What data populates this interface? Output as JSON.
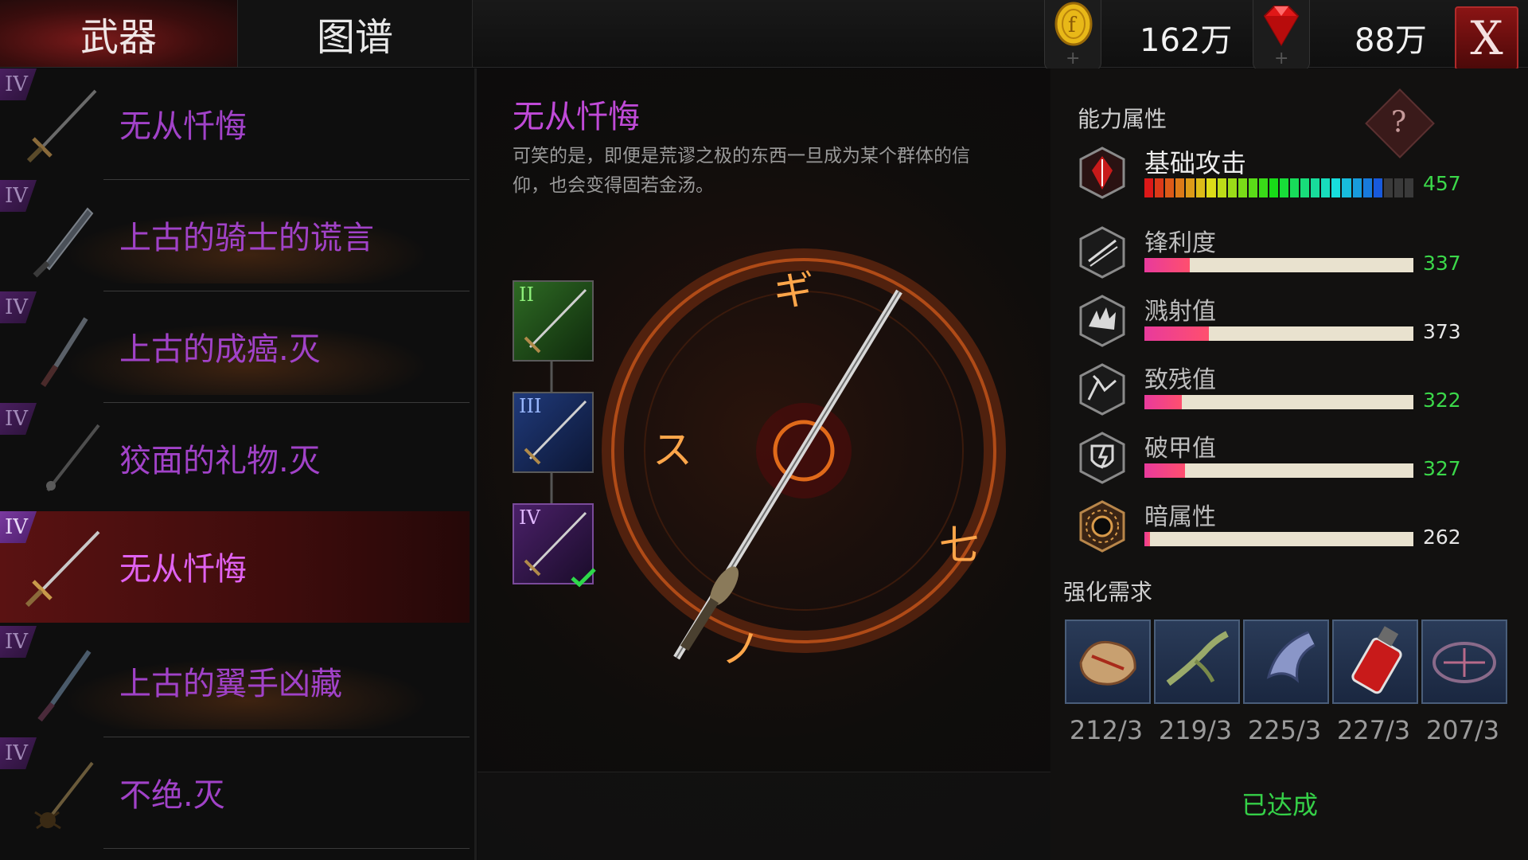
{
  "tabs": {
    "weapons": "武器",
    "codex": "图谱"
  },
  "currency": {
    "gold": {
      "icon": "gold-coin-icon",
      "value": "162万"
    },
    "gem": {
      "icon": "red-gem-icon",
      "value": "88万"
    },
    "plus": "+"
  },
  "close_label": "X",
  "weapon_list": [
    {
      "rank": "IV",
      "name": "无从忏悔",
      "icon": "sword-icon"
    },
    {
      "rank": "IV",
      "name": "上古的骑士的谎言",
      "icon": "greatsword-icon"
    },
    {
      "rank": "IV",
      "name": "上古的成癌.灭",
      "icon": "dagger-icon"
    },
    {
      "rank": "IV",
      "name": "狡面的礼物.灭",
      "icon": "spear-icon"
    },
    {
      "rank": "IV",
      "name": "无从忏悔",
      "icon": "sword-icon"
    },
    {
      "rank": "IV",
      "name": "上古的翼手凶藏",
      "icon": "blade-icon"
    },
    {
      "rank": "IV",
      "name": "不绝.灭",
      "icon": "spider-blade-icon"
    }
  ],
  "selected_weapon": {
    "name": "无从忏悔",
    "description": "可笑的是，即便是荒谬之极的东西一旦成为某个群体的信仰，也会变得固若金汤。",
    "tiers": [
      {
        "label": "II",
        "color": "#1f4a1a",
        "num_color": "#7ee06a"
      },
      {
        "label": "III",
        "color": "#15244a",
        "num_color": "#8aa8ff"
      },
      {
        "label": "IV",
        "color": "#2a1640",
        "num_color": "#d7a8ff",
        "current": true
      }
    ]
  },
  "attributes": {
    "title": "能力属性",
    "help": "?",
    "stats": [
      {
        "label": "基础攻击",
        "value": "457",
        "fraction": 0.88,
        "type": "rainbow",
        "value_color": "green",
        "icon": "attack-shield-icon"
      },
      {
        "label": "锋利度",
        "value": "337",
        "fraction": 0.17,
        "type": "bar",
        "value_color": "green",
        "icon": "sharpness-icon"
      },
      {
        "label": "溅射值",
        "value": "373",
        "fraction": 0.24,
        "type": "bar",
        "value_color": "white",
        "icon": "splash-icon"
      },
      {
        "label": "致残值",
        "value": "322",
        "fraction": 0.14,
        "type": "bar",
        "value_color": "green",
        "icon": "cripple-icon"
      },
      {
        "label": "破甲值",
        "value": "327",
        "fraction": 0.15,
        "type": "bar",
        "value_color": "green",
        "icon": "armor-break-icon"
      },
      {
        "label": "暗属性",
        "value": "262",
        "fraction": 0.02,
        "type": "bar",
        "value_color": "white",
        "icon": "dark-element-icon"
      }
    ]
  },
  "upgrade": {
    "title": "强化需求",
    "materials": [
      {
        "icon": "bone-material-icon",
        "count": "212/3"
      },
      {
        "icon": "claw-material-icon",
        "count": "219/3"
      },
      {
        "icon": "talon-material-icon",
        "count": "225/3"
      },
      {
        "icon": "blood-vial-icon",
        "count": "227/3"
      },
      {
        "icon": "rune-material-icon",
        "count": "207/3"
      }
    ],
    "status": "已达成"
  }
}
